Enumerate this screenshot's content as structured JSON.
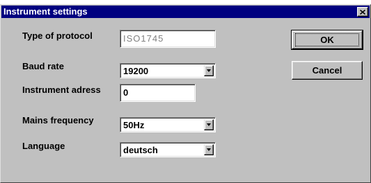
{
  "window": {
    "title": "Instrument settings",
    "close_glyph": "×"
  },
  "fields": {
    "protocol": {
      "label": "Type of protocol",
      "value": "ISO1745",
      "enabled": false
    },
    "baud_rate": {
      "label": "Baud rate",
      "value": "19200"
    },
    "instrument_address": {
      "label": "Instrument adress",
      "value": "0"
    },
    "mains_frequency": {
      "label": "Mains frequency",
      "value": "50Hz"
    },
    "language": {
      "label": "Language",
      "value": "deutsch"
    }
  },
  "buttons": {
    "ok": "OK",
    "cancel": "Cancel"
  },
  "colors": {
    "titlebar": "#000080",
    "dialog_face": "#c0c0c0",
    "disabled_text": "#808080"
  },
  "icons": {
    "close": "close-icon",
    "dropdown": "chevron-down-icon"
  }
}
